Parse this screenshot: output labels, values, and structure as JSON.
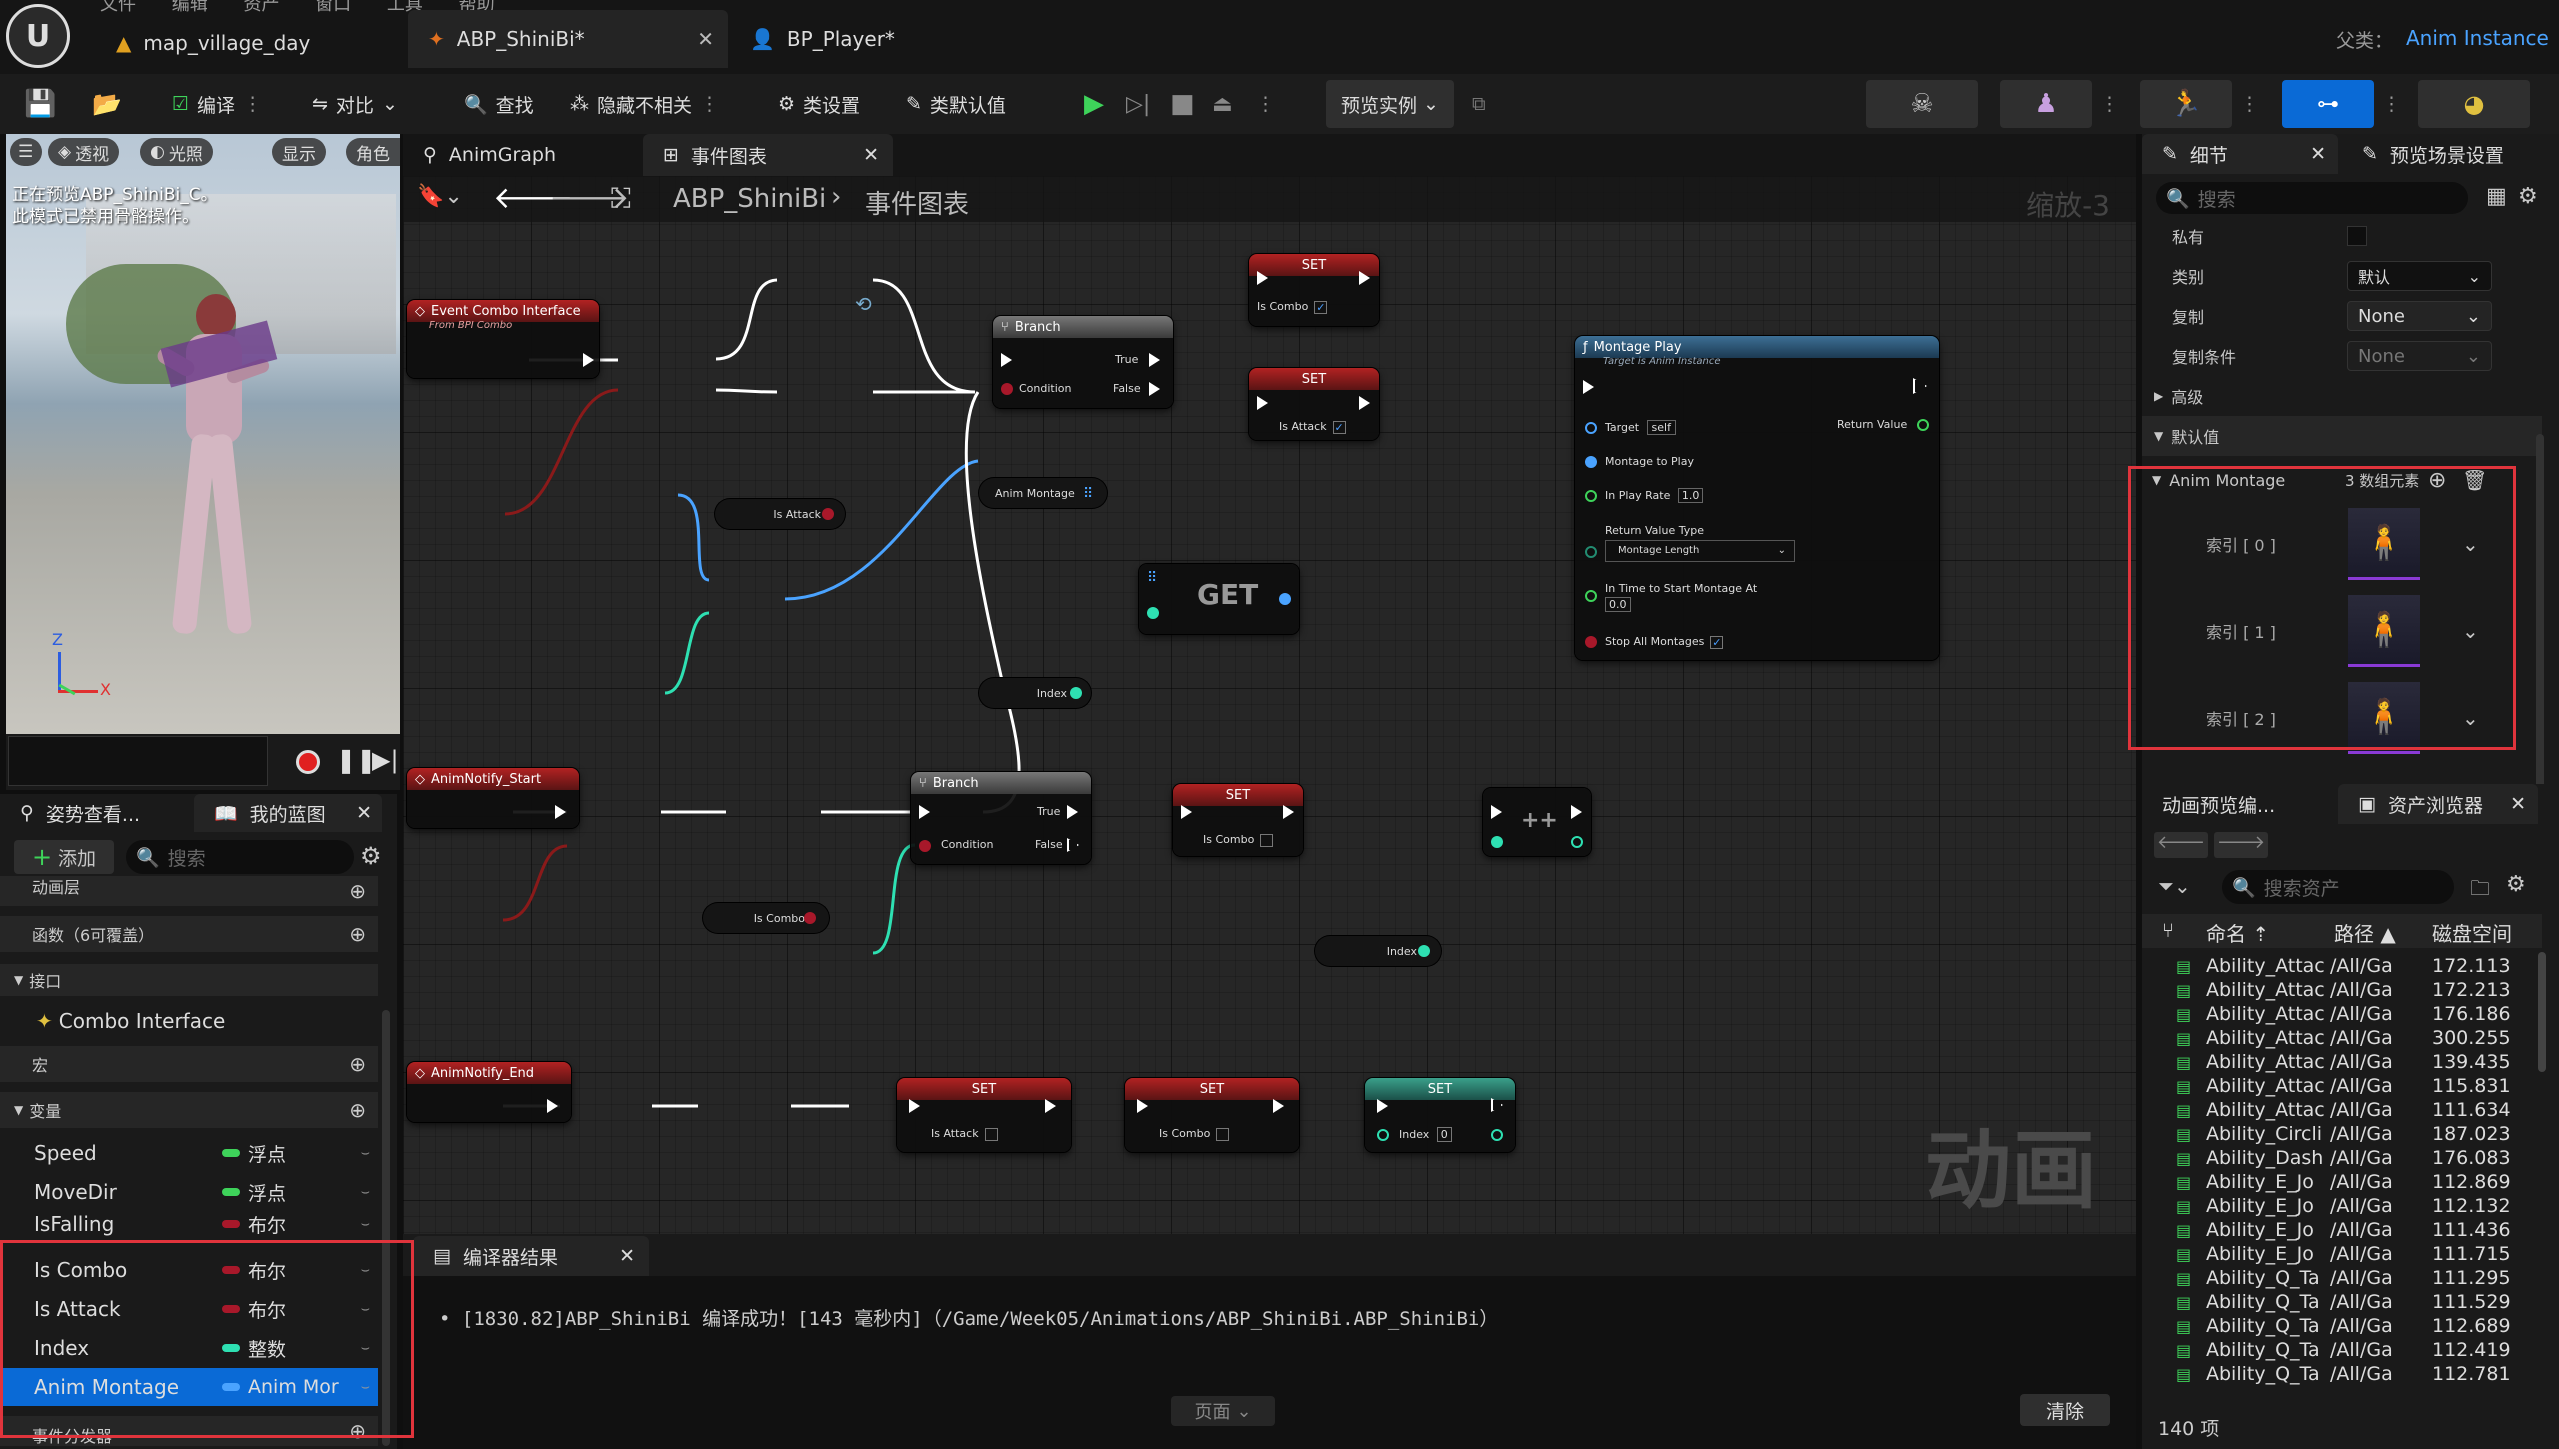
{
  "titlebar": {
    "menu": "文件  编辑  资产  窗口  工具  帮助",
    "tabs": [
      "map_village_day",
      "ABP_ShiniBi*",
      "BP_Player*"
    ],
    "parent_label": "父类：",
    "parent_value": "Anim Instance"
  },
  "toolbar": {
    "compile": "编译",
    "diff": "对比",
    "find": "查找",
    "hide_unrelated": "隐藏不相关",
    "class_settings": "类设置",
    "class_defaults": "类默认值",
    "preview_instance": "预览实例"
  },
  "viewport": {
    "perspective": "透视",
    "lit": "光照",
    "show": "显示",
    "character": "角色",
    "overlay_line1": "正在预览ABP_ShiniBi_C。",
    "overlay_line2": "此模式已禁用骨骼操作。",
    "axis_x": "X",
    "axis_z": "Z"
  },
  "graph": {
    "tabs": [
      "AnimGraph",
      "事件图表"
    ],
    "breadcrumb_root": "ABP_ShiniBi",
    "breadcrumb_leaf": "事件图表",
    "zoom": "缩放-3",
    "watermark": "动画"
  },
  "nodes": {
    "event_combo": {
      "title": "Event Combo Interface",
      "sub": "From BPI Combo"
    },
    "branch1": {
      "title": "Branch",
      "condition": "Condition",
      "true": "True",
      "false": "False"
    },
    "set_combo_true": {
      "title": "SET",
      "pin": "Is Combo"
    },
    "set_attack_true": {
      "title": "SET",
      "pin": "Is Attack"
    },
    "is_attack_var": "Is Attack",
    "anim_montage_var": "Anim Montage",
    "get": "GET",
    "index_var": "Index",
    "montage_play": {
      "title": "Montage Play",
      "sub": "Target is Anim Instance",
      "target": "Target",
      "self": "self",
      "montage": "Montage to Play",
      "rate": "In Play Rate",
      "rate_val": "1.0",
      "return_value": "Return Value",
      "rvt": "Return Value Type",
      "rvt_val": "Montage Length",
      "start": "In Time to Start Montage At",
      "start_val": "0.0",
      "stop": "Stop All Montages"
    },
    "notify_start": {
      "title": "AnimNotify_Start"
    },
    "branch2": {
      "title": "Branch",
      "condition": "Condition",
      "true": "True",
      "false": "False"
    },
    "set_combo_false": {
      "title": "SET",
      "pin": "Is Combo"
    },
    "is_combo_var": "Is Combo",
    "incr": "++",
    "index_var2": "Index",
    "notify_end": {
      "title": "AnimNotify_End"
    },
    "set_attack_false": {
      "title": "SET",
      "pin": "Is Attack"
    },
    "set_combo_false2": {
      "title": "SET",
      "pin": "Is Combo"
    },
    "set_index": {
      "title": "SET",
      "pin": "Index",
      "val": "0"
    }
  },
  "compiler": {
    "tab": "编译器结果",
    "message": "[1830.82]ABP_ShiniBi 编译成功！[143 毫秒内]（/Game/Week05/Animations/ABP_ShiniBi.ABP_ShiniBi）",
    "page": "页面",
    "clear": "清除"
  },
  "mybp": {
    "tabs": [
      "姿势查看...",
      "我的蓝图"
    ],
    "add": "添加",
    "search": "搜索",
    "anim_layers": "动画层",
    "functions": "函数（6可覆盖）",
    "interfaces": "接口",
    "combo_interface": "Combo Interface",
    "macros": "宏",
    "variables": "变量",
    "event_dispatchers": "事件分发器",
    "vars": [
      {
        "name": "Speed",
        "type": "浮点",
        "color": "#3ed35a"
      },
      {
        "name": "MoveDir",
        "type": "浮点",
        "color": "#3ed35a"
      },
      {
        "name": "IsFalling",
        "type": "布尔",
        "color": "#a8182a"
      },
      {
        "name": "Is Combo",
        "type": "布尔",
        "color": "#a8182a"
      },
      {
        "name": "Is Attack",
        "type": "布尔",
        "color": "#a8182a"
      },
      {
        "name": "Index",
        "type": "整数",
        "color": "#2ee0b2"
      },
      {
        "name": "Anim Montage",
        "type": "Anim Mor",
        "color": "#4aa3ff"
      }
    ]
  },
  "details": {
    "tabs": [
      "细节",
      "预览场景设置"
    ],
    "search": "搜索",
    "private": "私有",
    "category": "类别",
    "category_val": "默认",
    "replication": "复制",
    "replication_val": "None",
    "rep_condition": "复制条件",
    "rep_condition_val": "None",
    "advanced": "高级",
    "defaults": "默认值",
    "anim_montage": "Anim Montage",
    "array_count": "3 数组元素",
    "index0": "索引 [ 0 ]",
    "index1": "索引 [ 1 ]",
    "index2": "索引 [ 2 ]"
  },
  "assets": {
    "tabs": [
      "动画预览编...",
      "资产浏览器"
    ],
    "search": "搜索资产",
    "col_name": "命名",
    "col_path": "路径",
    "col_disk": "磁盘空间",
    "count": "140 项",
    "rows": [
      [
        "Ability_Attac",
        "/All/Ga",
        "172.113"
      ],
      [
        "Ability_Attac",
        "/All/Ga",
        "172.213"
      ],
      [
        "Ability_Attac",
        "/All/Ga",
        "176.186"
      ],
      [
        "Ability_Attac",
        "/All/Ga",
        "300.255"
      ],
      [
        "Ability_Attac",
        "/All/Ga",
        "139.435"
      ],
      [
        "Ability_Attac",
        "/All/Ga",
        "115.831"
      ],
      [
        "Ability_Attac",
        "/All/Ga",
        "111.634"
      ],
      [
        "Ability_Circli",
        "/All/Ga",
        "187.023"
      ],
      [
        "Ability_Dash",
        "/All/Ga",
        "176.083"
      ],
      [
        "Ability_E_Jo",
        "/All/Ga",
        "112.869"
      ],
      [
        "Ability_E_Jo",
        "/All/Ga",
        "112.132"
      ],
      [
        "Ability_E_Jo",
        "/All/Ga",
        "111.436"
      ],
      [
        "Ability_E_Jo",
        "/All/Ga",
        "111.715"
      ],
      [
        "Ability_Q_Ta",
        "/All/Ga",
        "111.295"
      ],
      [
        "Ability_Q_Ta",
        "/All/Ga",
        "111.529"
      ],
      [
        "Ability_Q_Ta",
        "/All/Ga",
        "112.689"
      ],
      [
        "Ability_Q_Ta",
        "/All/Ga",
        "112.419"
      ],
      [
        "Ability_Q_Ta",
        "/All/Ga",
        "112.781"
      ]
    ]
  }
}
